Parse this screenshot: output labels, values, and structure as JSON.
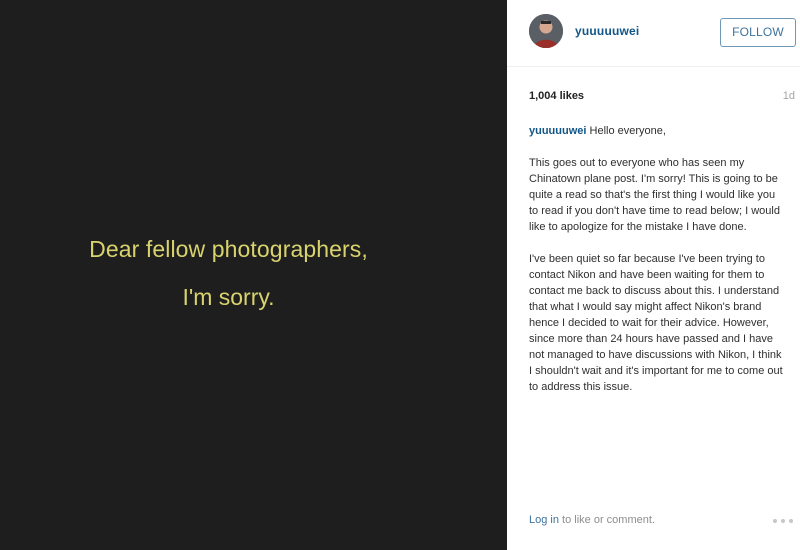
{
  "photo": {
    "line1": "Dear fellow photographers,",
    "line2": "I'm sorry.",
    "text_color": "#d9d36e"
  },
  "header": {
    "username": "yuuuuuwei",
    "follow_label": "FOLLOW"
  },
  "meta": {
    "likes": "1,004 likes",
    "time": "1d"
  },
  "caption": {
    "username": "yuuuuuwei",
    "greeting": "Hello everyone,",
    "paragraph1": "This goes out to everyone who has seen my Chinatown plane post. I'm sorry! This is going to be quite a read so that's the first thing I would like you to read if you don't have time to read below; I would like to apologize for the mistake I have done.",
    "paragraph2": "I've been quiet so far because I've been trying to contact Nikon and have been waiting for them to contact me back to discuss about this. I understand that what I would say might affect Nikon's brand hence I decided to wait for their advice. However, since more than 24 hours have passed and I have not managed to have discussions with Nikon, I think I shouldn't wait and it's important for me to come out to address this issue."
  },
  "footer": {
    "login_label": "Log in",
    "login_suffix": " to like or comment."
  },
  "icons": {
    "avatar": "profile-photo",
    "more": "more-options-icon"
  },
  "colors": {
    "accent": "#3f729b",
    "username": "#125688"
  }
}
